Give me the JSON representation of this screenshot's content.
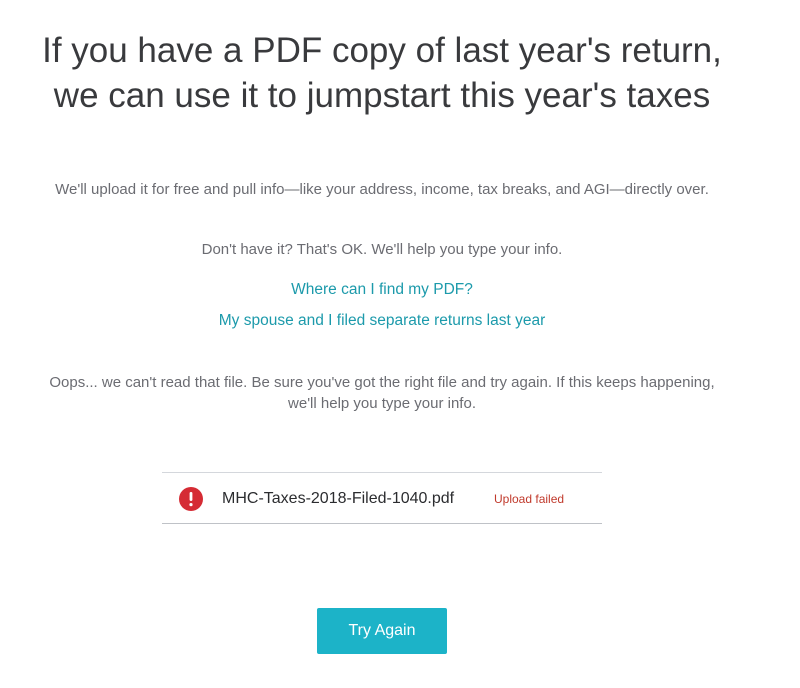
{
  "header": {
    "title": "If you have a PDF copy of last year's return, we can use it to jumpstart this year's taxes"
  },
  "intro": {
    "subtitle": "We'll upload it for free and pull info—like your address, income, tax breaks, and AGI—directly over.",
    "no_pdf_text": "Don't have it? That's OK. We'll help you type your info."
  },
  "links": {
    "find_pdf": "Where can I find my PDF?",
    "separate_returns": "My spouse and I filed separate returns last year"
  },
  "error": {
    "message": "Oops... we can't read that file. Be sure you've got the right file and try again. If this keeps happening, we'll help you type your info."
  },
  "upload": {
    "file_name": "MHC-Taxes-2018-Filed-1040.pdf",
    "status": "Upload failed",
    "icon": "alert-circle-icon",
    "status_color": "#c0392b",
    "icon_color": "#d52b34"
  },
  "actions": {
    "try_again_label": "Try Again",
    "button_color": "#1cb3c8"
  }
}
